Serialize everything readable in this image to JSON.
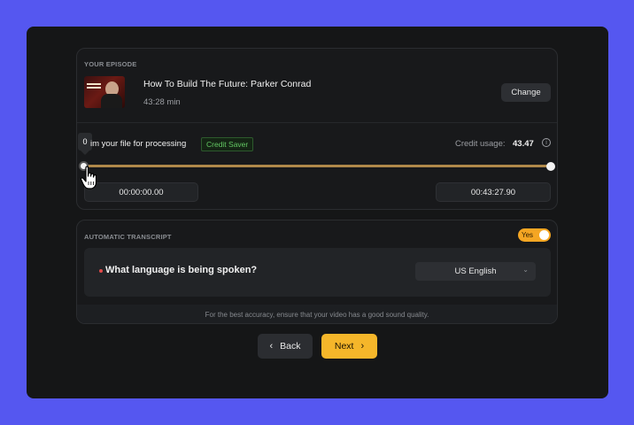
{
  "episode": {
    "section_label": "YOUR EPISODE",
    "title": "How To Build The Future: Parker Conrad",
    "duration": "43:28 min",
    "change_label": "Change"
  },
  "trim": {
    "tooltip_value": "0",
    "label": "im your file for processing",
    "badge": "Credit Saver",
    "credit_usage_label": "Credit usage:",
    "credit_usage_value": "43.47",
    "start_time": "00:00:00.00",
    "end_time": "00:43:27.90"
  },
  "transcript": {
    "section_label": "AUTOMATIC TRANSCRIPT",
    "toggle_label": "Yes",
    "question": "What language is being spoken?",
    "language": "US English",
    "footer_note": "For the best accuracy, ensure that your video has a good sound quality."
  },
  "nav": {
    "back_label": "Back",
    "next_label": "Next"
  },
  "colors": {
    "background": "#5557f0",
    "accent": "#f5b62a",
    "credit_saver": "#63c763",
    "track": "#b0894a"
  },
  "icons": [
    "info-icon",
    "hand-cursor-icon",
    "chevron-down-icon",
    "chevron-left-icon",
    "chevron-right-icon"
  ]
}
